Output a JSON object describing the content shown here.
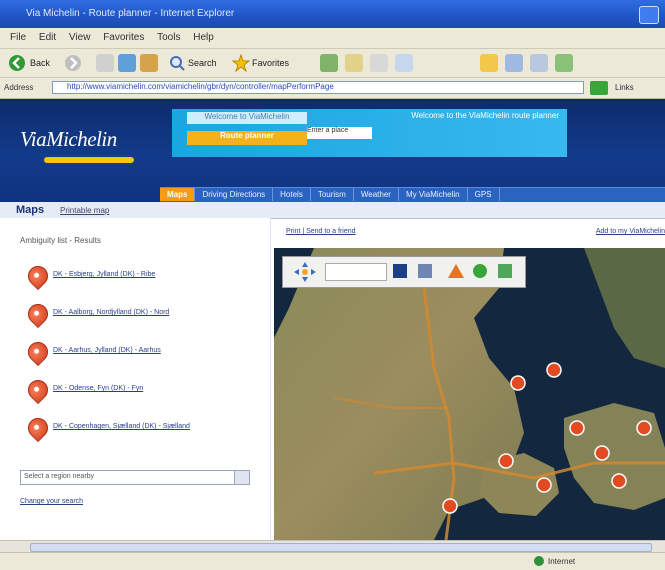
{
  "window": {
    "title": "Via Michelin - Route planner - Internet Explorer"
  },
  "menu": [
    "File",
    "Edit",
    "View",
    "Favorites",
    "Tools",
    "Help"
  ],
  "toolbar": {
    "back_label": "Back",
    "search_label": "Search",
    "favorites_label": "Favorites"
  },
  "address": {
    "label": "Address",
    "value": "http://www.viamichelin.com/viamichelin/gbr/dyn/controller/mapPerformPage",
    "go": "Go",
    "links": "Links"
  },
  "site": {
    "logo": "ViaMichelin",
    "banner": {
      "top": "Welcome to ViaMichelin",
      "mid": "Route planner",
      "box": "Enter a place",
      "right": "Welcome to the ViaMichelin route planner"
    },
    "nav": [
      "Maps",
      "Driving Directions",
      "Hotels",
      "Tourism",
      "Weather",
      "My ViaMichelin",
      "GPS"
    ]
  },
  "mapsbar": {
    "title": "Maps",
    "subtitle": "Printable map"
  },
  "left": {
    "header": "Ambiguity list - Results",
    "results": [
      "DK - Esbjerg, Jylland (DK) - Ribe",
      "DK - Aalborg, Nordjylland (DK) - Nord",
      "DK - Aarhus, Jylland (DK) - Aarhus",
      "DK - Odense, Fyn (DK) - Fyn",
      "DK - Copenhagen, Sjælland (DK) - Sjælland"
    ],
    "select_placeholder": "Select a region nearby",
    "change_link": "Change your search"
  },
  "map": {
    "print_link": "Print | Send to a friend",
    "right_link": "Add to my ViaMichelin"
  },
  "status": {
    "zone": "Internet"
  }
}
